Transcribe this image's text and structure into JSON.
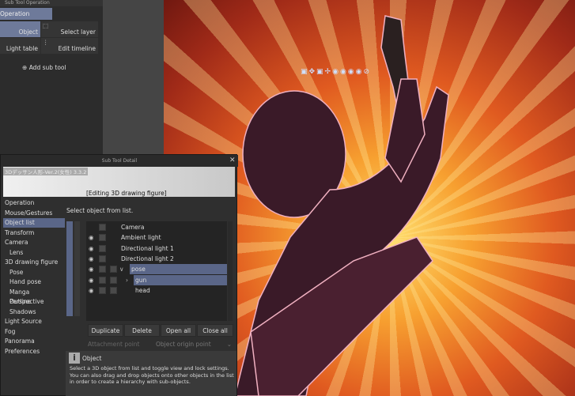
{
  "sub_tool_operation": {
    "title": "Sub Tool Operation",
    "tab": "Operation",
    "tools": [
      "Object",
      "Select layer",
      "Light table",
      "Edit timeline"
    ],
    "add": "Add sub tool"
  },
  "dialog": {
    "title": "Sub Tool Detail",
    "tool_name": "3Dデッサン人形-Ver.2(女性) 3.3.2",
    "editing": "[Editing 3D drawing figure]",
    "categories": [
      "Operation",
      "Mouse/Gestures",
      "Object list",
      "Transform",
      "Camera",
      "Lens",
      "3D drawing figure",
      "Pose",
      "Hand pose",
      "Manga Perspective",
      "Outline",
      "Shadows",
      "Light Source",
      "Fog",
      "Panorama",
      "Preferences"
    ],
    "selected_category": "Object list",
    "prompt": "Select object from list.",
    "objects": [
      "Camera",
      "Ambient light",
      "Directional light 1",
      "Directional light 2",
      "pose",
      "gun",
      "head"
    ],
    "buttons": [
      "Duplicate",
      "Delete",
      "Open all",
      "Close all"
    ],
    "attachment_label": "Attachment point",
    "attachment_value": "Object origin point",
    "info_title": "Object",
    "info_text": "Select a 3D object from list and toggle view and lock settings. You can also drag and drop objects onto other objects in the list in order to create a hierarchy with sub-objects."
  },
  "colors": {
    "selection": "#5a6688",
    "canvas_orange": "#e05a20"
  }
}
